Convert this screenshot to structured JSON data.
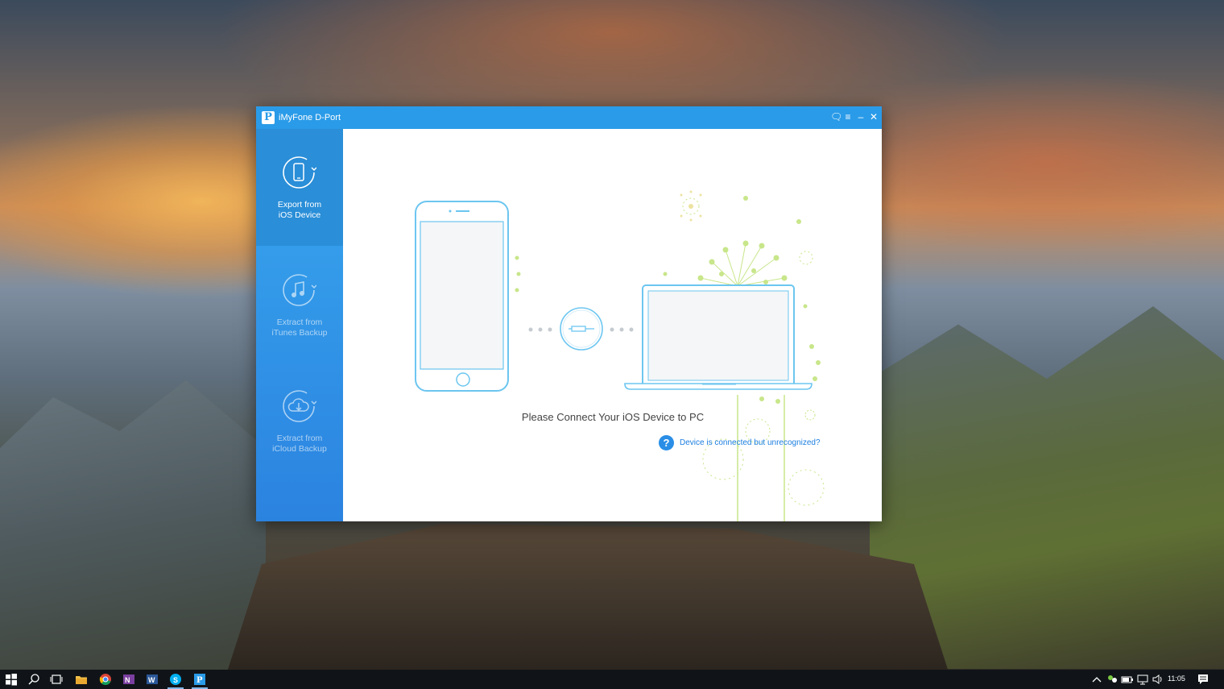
{
  "window": {
    "title": "iMyFone D-Port",
    "logo_letter": "P",
    "controls": {
      "feedback": "🗨",
      "menu": "≡",
      "minimize": "–",
      "close": "✕"
    }
  },
  "sidebar": {
    "items": [
      {
        "line1": "Export from",
        "line2": "iOS Device",
        "icon": "phone-sync-icon",
        "active": true
      },
      {
        "line1": "Extract from",
        "line2": "iTunes Backup",
        "icon": "music-note-icon",
        "active": false
      },
      {
        "line1": "Extract from",
        "line2": "iCloud Backup",
        "icon": "cloud-download-icon",
        "active": false
      }
    ]
  },
  "main": {
    "connect_message": "Please Connect Your iOS Device to PC",
    "help_icon": "?",
    "help_link": "Device is connected but unrecognized?"
  },
  "taskbar": {
    "clock": "11:05",
    "apps": [
      "start-icon",
      "search-icon",
      "task-view-icon",
      "file-explorer-icon",
      "chrome-icon",
      "onenote-icon",
      "word-icon",
      "skype-icon",
      "dport-icon"
    ],
    "tray": [
      "chevron-up-icon",
      "network-people-icon",
      "battery-icon",
      "wifi-icon",
      "volume-icon"
    ]
  },
  "colors": {
    "accent": "#2a9be8",
    "sidebar_top": "#38a7ee",
    "sidebar_bottom": "#2b83e0",
    "illustration_line": "#6cc6f0",
    "illustration_dots": "#c8e68a"
  }
}
